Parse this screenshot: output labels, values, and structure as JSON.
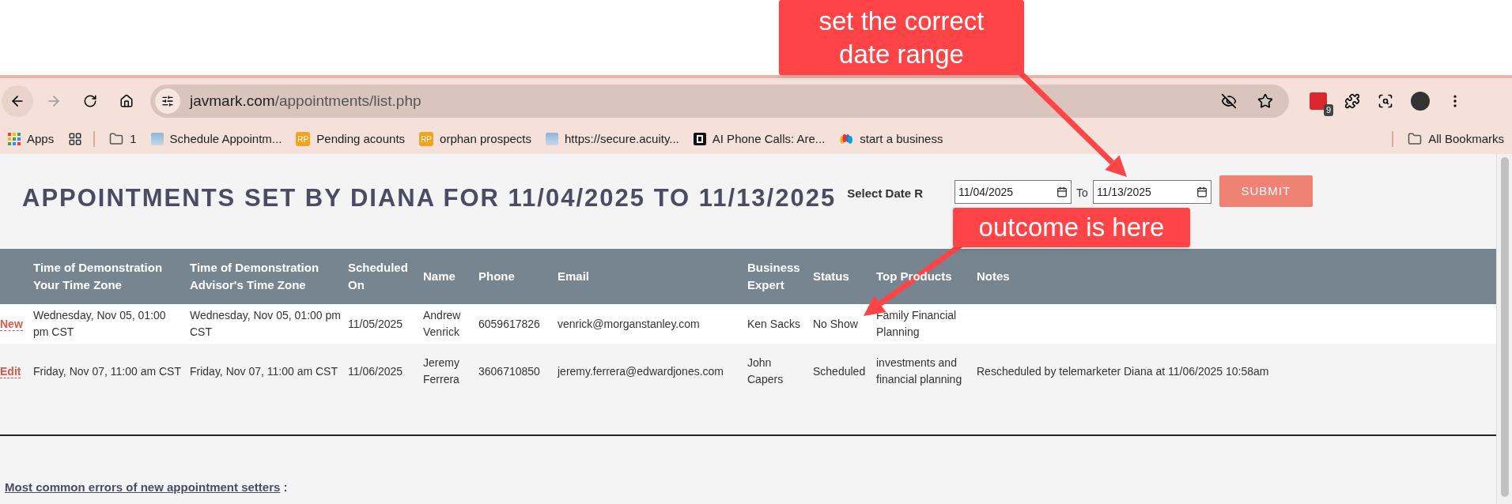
{
  "browser": {
    "url_host": "javmark.com",
    "url_path": "/appointments/list.php",
    "extension_badge": "9",
    "bookmarks": [
      {
        "kind": "apps",
        "label": "Apps"
      },
      {
        "kind": "grid"
      },
      {
        "kind": "folder",
        "label": "1"
      },
      {
        "kind": "page",
        "label": "Schedule Appointm..."
      },
      {
        "kind": "rp",
        "badge": "RP",
        "label": "Pending acounts"
      },
      {
        "kind": "rp",
        "badge": "RP",
        "label": "orphan prospects"
      },
      {
        "kind": "page",
        "label": "https://secure.acuity..."
      },
      {
        "kind": "film",
        "label": "AI Phone Calls: Are..."
      },
      {
        "kind": "peacock",
        "label": "start a business"
      }
    ],
    "all_bookmarks": "All Bookmarks"
  },
  "page": {
    "title": "APPOINTMENTS SET BY DIANA FOR 11/04/2025 TO 11/13/2025",
    "date_filter": {
      "label": "Select Date R",
      "from": "11/04/2025",
      "to_label": "To",
      "to": "11/13/2025",
      "submit": "SUBMIT"
    },
    "table": {
      "columns": [
        "",
        "Time of Demonstration Your Time Zone",
        "Time of Demonstration Advisor's Time Zone",
        "Scheduled On",
        "Name",
        "Phone",
        "Email",
        "Business Expert",
        "Status",
        "Top Products",
        "Notes"
      ],
      "rows": [
        [
          "New",
          "Wednesday, Nov 05, 01:00 pm CST",
          "Wednesday, Nov 05, 01:00 pm CST",
          "11/05/2025",
          "Andrew Venrick",
          "6059617826",
          "venrick@morganstanley.com",
          "Ken Sacks",
          "No Show",
          "Family Financial Planning",
          ""
        ],
        [
          "Edit",
          "Friday, Nov 07, 11:00 am CST",
          "Friday, Nov 07, 11:00 am CST",
          "11/06/2025",
          "Jeremy Ferrera",
          "3606710850",
          "jeremy.ferrera@edwardjones.com",
          "John Capers",
          "Scheduled",
          "investments and financial planning",
          "Rescheduled by telemarketer Diana at 11/06/2025 10:58am"
        ]
      ]
    },
    "errors_link": "Most common errors of new appointment setters",
    "errors_suffix": " :"
  },
  "annotations": [
    {
      "text": "set the correct date range"
    },
    {
      "text": "outcome is here"
    }
  ]
}
